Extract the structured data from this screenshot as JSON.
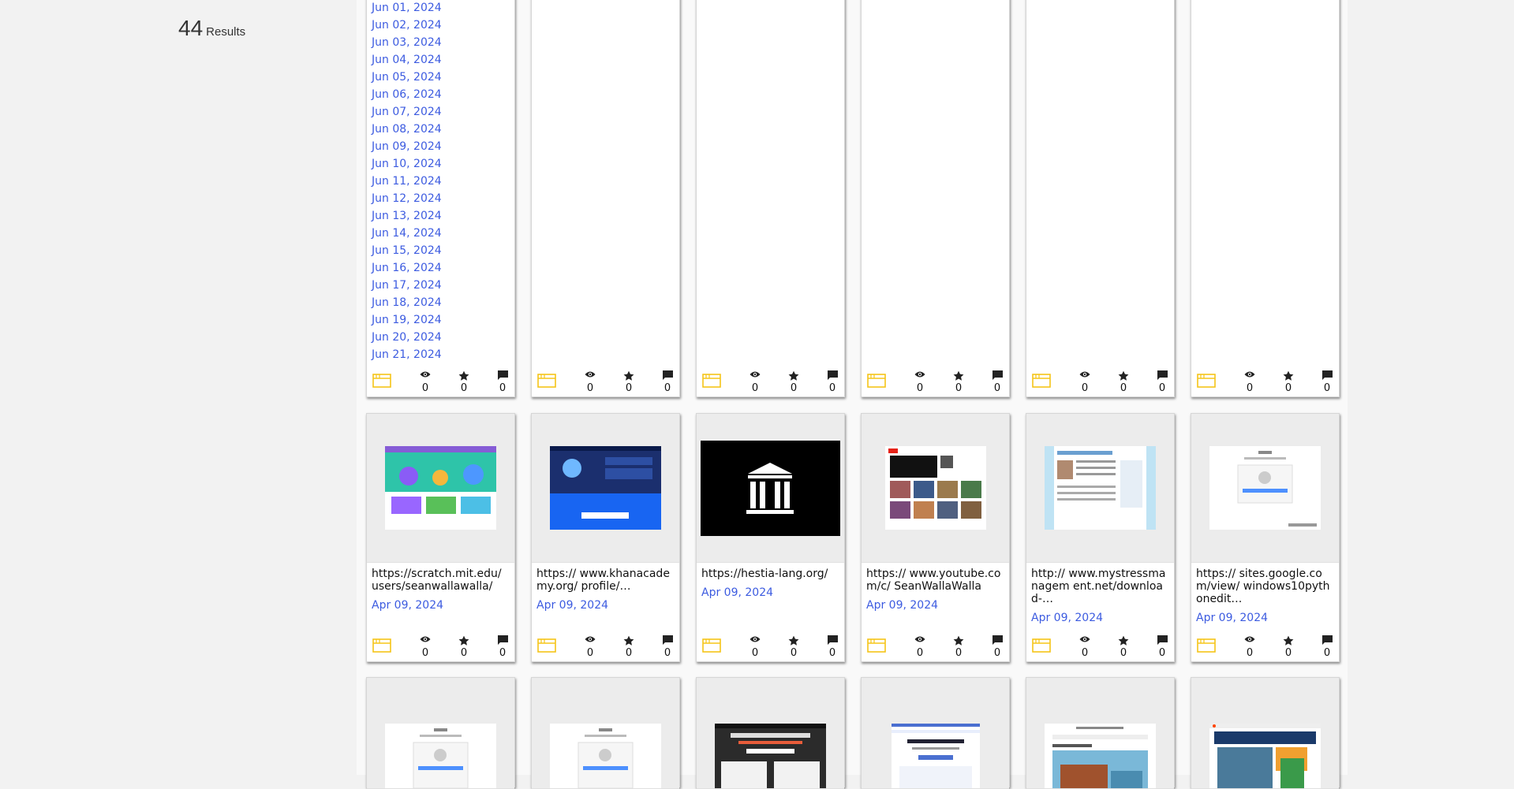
{
  "results": {
    "count": "44",
    "label": "Results"
  },
  "top_row": {
    "dates": [
      "Jun 01, 2024",
      "Jun 02, 2024",
      "Jun 03, 2024",
      "Jun 04, 2024",
      "Jun 05, 2024",
      "Jun 06, 2024",
      "Jun 07, 2024",
      "Jun 08, 2024",
      "Jun 09, 2024",
      "Jun 10, 2024",
      "Jun 11, 2024",
      "Jun 12, 2024",
      "Jun 13, 2024",
      "Jun 14, 2024",
      "Jun 15, 2024",
      "Jun 16, 2024",
      "Jun 17, 2024",
      "Jun 18, 2024",
      "Jun 19, 2024",
      "Jun 20, 2024",
      "Jun 21, 2024"
    ],
    "stats": [
      {
        "views": "0",
        "stars": "0",
        "comments": "0"
      },
      {
        "views": "0",
        "stars": "0",
        "comments": "0"
      },
      {
        "views": "0",
        "stars": "0",
        "comments": "0"
      },
      {
        "views": "0",
        "stars": "0",
        "comments": "0"
      },
      {
        "views": "0",
        "stars": "0",
        "comments": "0"
      },
      {
        "views": "0",
        "stars": "0",
        "comments": "0"
      }
    ]
  },
  "middle_row": [
    {
      "url": "https://scratch.mit.edu/ users/seanwallawalla/",
      "date": "Apr 09, 2024",
      "views": "0",
      "stars": "0",
      "comments": "0",
      "thumb": "scratch-page-thumbnail"
    },
    {
      "url": "https:// www.khanacademy.org/ profile/…",
      "date": "Apr 09, 2024",
      "views": "0",
      "stars": "0",
      "comments": "0",
      "thumb": "khanacademy-page-thumbnail"
    },
    {
      "url": "https://hestia-lang.org/",
      "date": "Apr 09, 2024",
      "views": "0",
      "stars": "0",
      "comments": "0",
      "thumb": "archive-building-icon"
    },
    {
      "url": "https:// www.youtube.com/c/ SeanWallaWalla",
      "date": "Apr 09, 2024",
      "views": "0",
      "stars": "0",
      "comments": "0",
      "thumb": "youtube-page-thumbnail"
    },
    {
      "url": "http:// www.mystressmanagem ent.net/download-…",
      "date": "Apr 09, 2024",
      "views": "0",
      "stars": "0",
      "comments": "0",
      "thumb": "stress-site-thumbnail"
    },
    {
      "url": "https:// sites.google.com/view/ windows10pythonedit…",
      "date": "Apr 09, 2024",
      "views": "0",
      "stars": "0",
      "comments": "0",
      "thumb": "google-signin-thumbnail"
    }
  ],
  "bottom_row": [
    {
      "thumb": "google-signin-thumbnail"
    },
    {
      "thumb": "google-signin-thumbnail"
    },
    {
      "thumb": "software-platform-thumbnail"
    },
    {
      "thumb": "professional-teams-thumbnail"
    },
    {
      "thumb": "resort-page-thumbnail"
    },
    {
      "thumb": "reddit-page-thumbnail"
    }
  ],
  "colors": {
    "date_link": "#3c5be0",
    "capture_icon": "#f5c518",
    "page_bg": "#f2f2f2"
  }
}
